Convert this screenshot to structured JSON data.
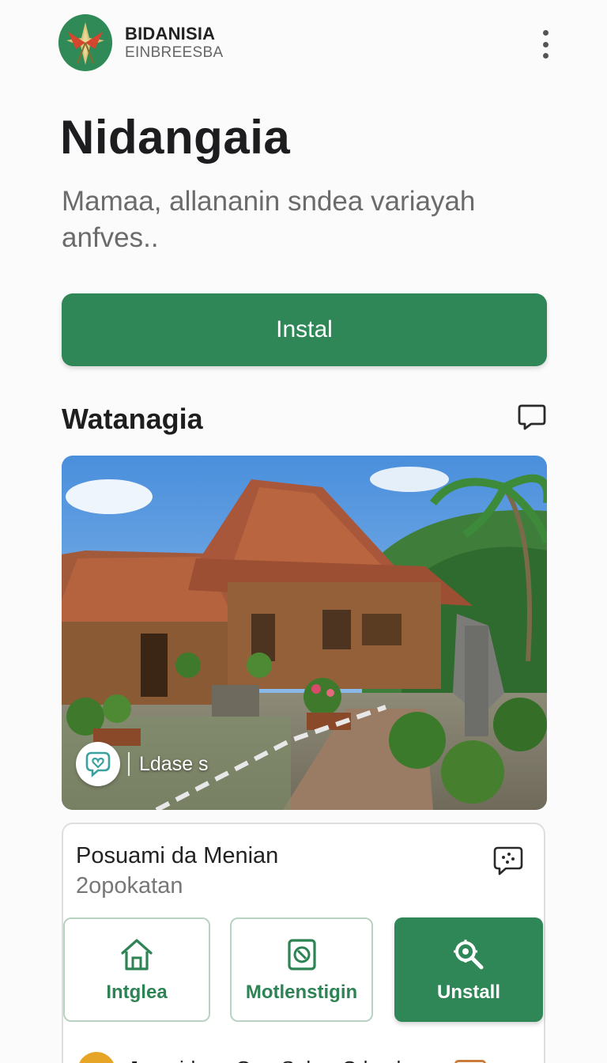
{
  "header": {
    "brand_name": "BIDANISIA",
    "brand_sub": "EINBREESBA",
    "logo_icon": "star-emblem-logo",
    "menu_icon": "more-vertical-icon"
  },
  "page": {
    "title": "Nidangaia",
    "description": "Mamaa, allananin sndea variayah anfves.."
  },
  "primary_action": {
    "label": "Instal"
  },
  "section": {
    "title": "Watanagia",
    "icon": "chat-bubble-icon"
  },
  "hero": {
    "badge_icon": "chat-heart-icon",
    "badge_label": "Ldase s"
  },
  "card": {
    "title": "Posuami da Menian",
    "subtitle": "2opokatan",
    "icon": "chat-dots-icon",
    "actions": [
      {
        "label": "Intglea",
        "icon": "home-icon",
        "style": "outline"
      },
      {
        "label": "Motlenstigin",
        "icon": "device-icon",
        "style": "outline"
      },
      {
        "label": "Unstall",
        "icon": "search-gear-icon",
        "style": "filled"
      }
    ],
    "peek_row": {
      "text": "Jaaeridex - Grp: Sahar Cdeydeaw",
      "icon": "sun-icon",
      "end_icon": "calendar-icon"
    }
  },
  "colors": {
    "accent": "#2f8656",
    "accent_border": "#b9d3c2",
    "logo_bg": "#2f8a57",
    "text_primary": "#1d1d1f",
    "text_secondary": "#6b6b6b"
  }
}
